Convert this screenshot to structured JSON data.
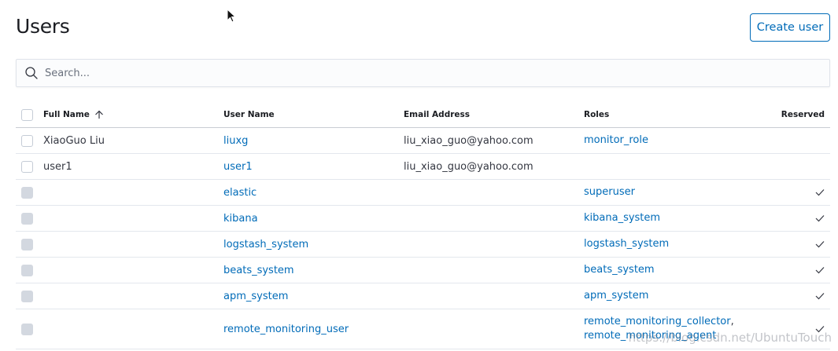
{
  "page": {
    "title": "Users"
  },
  "actions": {
    "create_user": "Create user"
  },
  "search": {
    "placeholder": "Search..."
  },
  "table": {
    "columns": {
      "full_name": "Full Name",
      "user_name": "User Name",
      "email": "Email Address",
      "roles": "Roles",
      "reserved": "Reserved"
    },
    "sort": {
      "column": "full_name",
      "direction": "ascending"
    },
    "rows": [
      {
        "full_name": "XiaoGuo Liu",
        "user_name": "liuxg",
        "email": "liu_xiao_guo@yahoo.com",
        "roles": [
          "monitor_role"
        ],
        "reserved": false
      },
      {
        "full_name": "user1",
        "user_name": "user1",
        "email": "liu_xiao_guo@yahoo.com",
        "roles": [],
        "reserved": false
      },
      {
        "full_name": "",
        "user_name": "elastic",
        "email": "",
        "roles": [
          "superuser"
        ],
        "reserved": true
      },
      {
        "full_name": "",
        "user_name": "kibana",
        "email": "",
        "roles": [
          "kibana_system"
        ],
        "reserved": true
      },
      {
        "full_name": "",
        "user_name": "logstash_system",
        "email": "",
        "roles": [
          "logstash_system"
        ],
        "reserved": true
      },
      {
        "full_name": "",
        "user_name": "beats_system",
        "email": "",
        "roles": [
          "beats_system"
        ],
        "reserved": true
      },
      {
        "full_name": "",
        "user_name": "apm_system",
        "email": "",
        "roles": [
          "apm_system"
        ],
        "reserved": true
      },
      {
        "full_name": "",
        "user_name": "remote_monitoring_user",
        "email": "",
        "roles": [
          "remote_monitoring_collector",
          "remote_monitoring_agent"
        ],
        "reserved": true
      }
    ]
  },
  "icons": {
    "search": "search-icon",
    "sort": "arrow-up-icon",
    "reserved": "check-icon",
    "cursor": "mouse-pointer-icon"
  },
  "colors": {
    "accent": "#006bb8",
    "title": "#1a1c21",
    "text": "#343741",
    "border": "#e3e7ed",
    "disabled_checkbox": "#d3d8e0"
  },
  "watermark": "https://blog.csdn.net/UbuntuTouch"
}
